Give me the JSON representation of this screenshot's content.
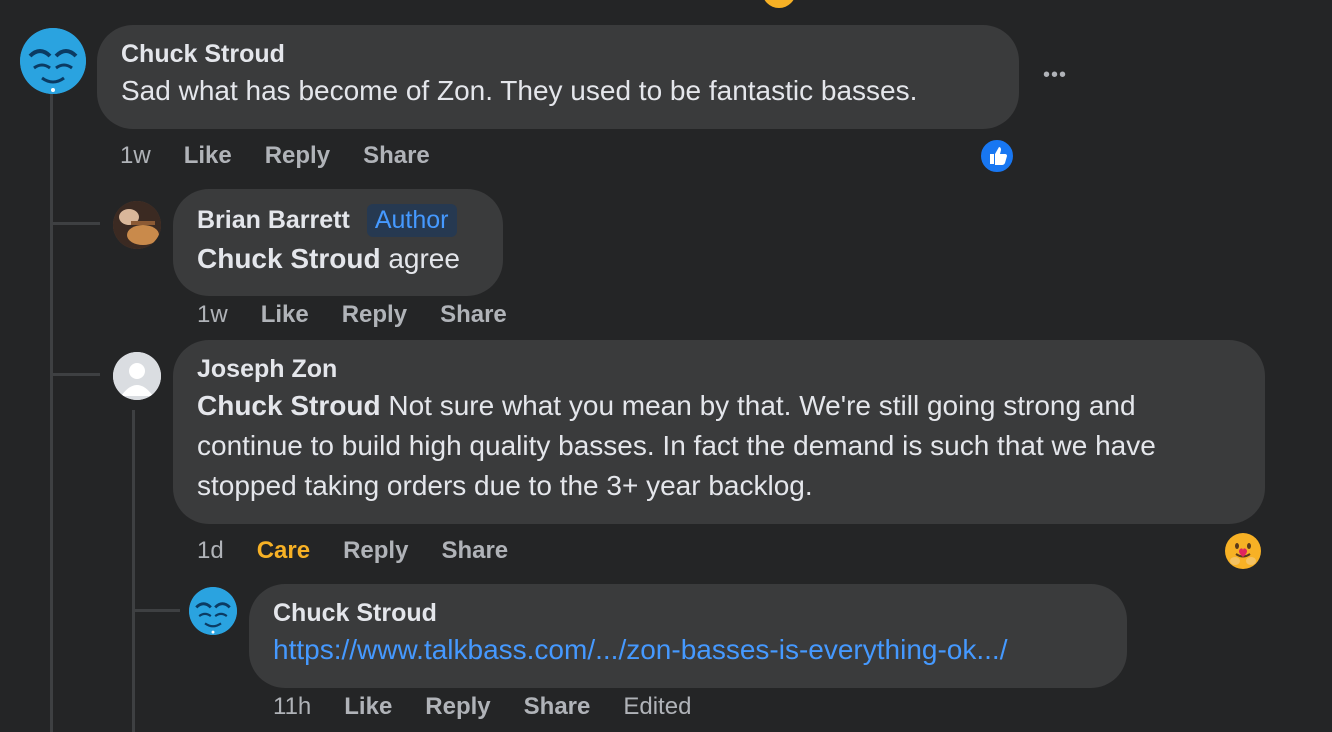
{
  "comments": [
    {
      "author": "Chuck Stroud",
      "text": "Sad what has become of Zon. They used to be fantastic basses.",
      "time": "1w",
      "actions": [
        "Like",
        "Reply",
        "Share"
      ],
      "reaction": "like"
    },
    {
      "author": "Brian Barrett",
      "badge": "Author",
      "mention": "Chuck Stroud",
      "text": " agree",
      "time": "1w",
      "actions": [
        "Like",
        "Reply",
        "Share"
      ]
    },
    {
      "author": "Joseph Zon",
      "mention": "Chuck Stroud",
      "text": " Not sure what you mean by that. We're still going strong and continue to build high quality basses. In fact the demand is such that we have stopped taking orders due to the 3+ year backlog.",
      "time": "1d",
      "actions": [
        "Care",
        "Reply",
        "Share"
      ],
      "reaction": "care"
    },
    {
      "author": "Chuck Stroud",
      "link": "https://www.talkbass.com/.../zon-basses-is-everything-ok.../",
      "time": "11h",
      "actions": [
        "Like",
        "Reply",
        "Share"
      ],
      "edited": "Edited"
    }
  ],
  "more_menu": "•••",
  "colors": {
    "background": "#242526",
    "bubble": "#3a3b3c",
    "link": "#4599ff",
    "care": "#f7b125",
    "like_blue": "#1877f2"
  }
}
